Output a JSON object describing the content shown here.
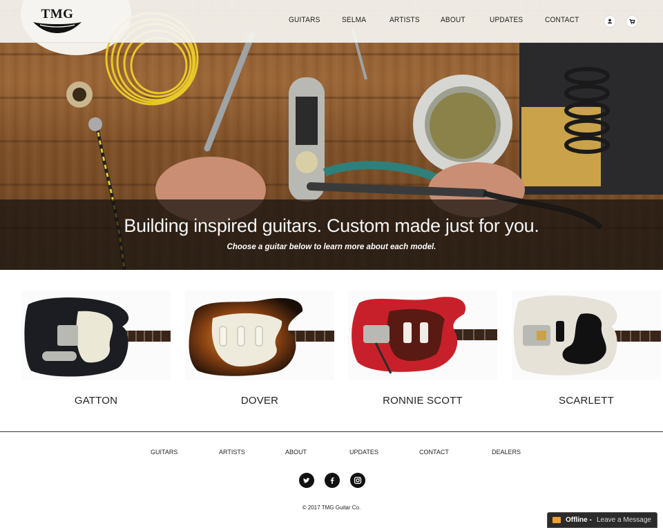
{
  "brand": {
    "logo_text": "TMG"
  },
  "nav": {
    "items": [
      {
        "label": "GUITARS"
      },
      {
        "label": "SELMA"
      },
      {
        "label": "ARTISTS"
      },
      {
        "label": "ABOUT"
      },
      {
        "label": "UPDATES"
      },
      {
        "label": "CONTACT"
      }
    ],
    "icons": [
      "user-icon",
      "cart-icon"
    ]
  },
  "hero": {
    "headline": "Building inspired guitars. Custom made just for you.",
    "subline": "Choose a guitar below to learn more about each model."
  },
  "guitars": [
    {
      "name": "GATTON",
      "body_color": "#1b1d22",
      "pickguard_color": "#ece8d6"
    },
    {
      "name": "DOVER",
      "body_color": "#6b3410",
      "pickguard_color": "#eeeadc"
    },
    {
      "name": "RONNIE SCOTT",
      "body_color": "#c8202a",
      "pickguard_color": "#5a1a14"
    },
    {
      "name": "SCARLETT",
      "body_color": "#e6e2d8",
      "pickguard_color": "#111111"
    }
  ],
  "footer": {
    "nav": [
      {
        "label": "GUITARS"
      },
      {
        "label": "ARTISTS"
      },
      {
        "label": "ABOUT"
      },
      {
        "label": "UPDATES"
      },
      {
        "label": "CONTACT"
      },
      {
        "label": "DEALERS"
      }
    ],
    "social": [
      "twitter-icon",
      "facebook-icon",
      "instagram-icon"
    ],
    "copyright": "© 2017 TMG Guitar Co."
  },
  "chat": {
    "status": "Offline -",
    "message": "Leave a Message"
  }
}
